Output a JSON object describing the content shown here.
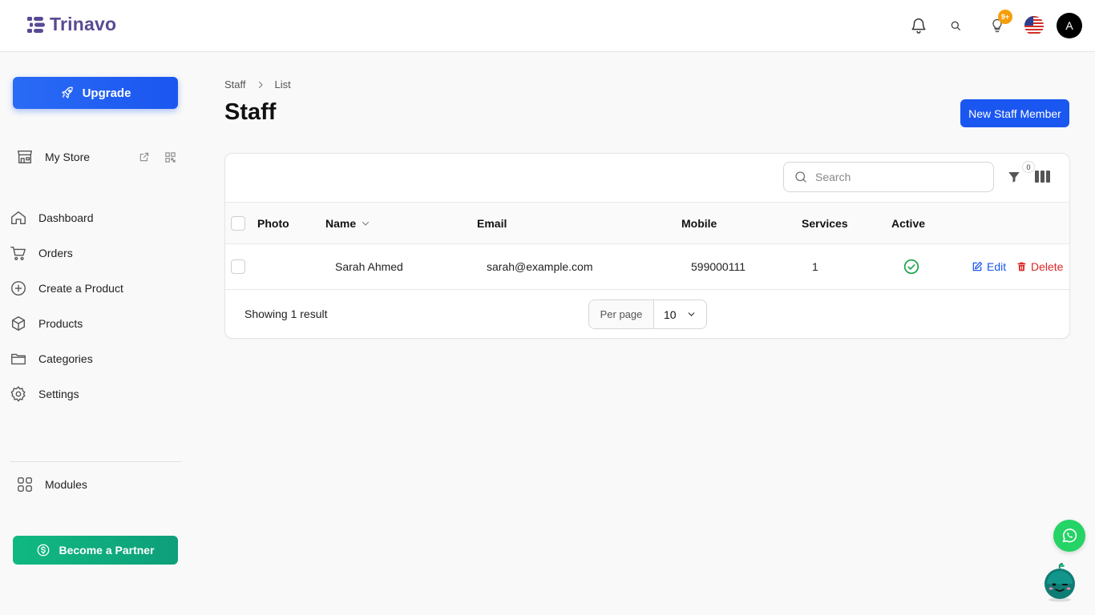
{
  "brand": {
    "name": "Trinavo",
    "color": "#5a4a93"
  },
  "header": {
    "notification_badge": "9+",
    "avatar_initial": "A",
    "language_flag": "us-flag-icon"
  },
  "sidebar": {
    "upgrade_label": "Upgrade",
    "store_label": "My Store",
    "items": [
      {
        "label": "Dashboard",
        "icon": "home-icon"
      },
      {
        "label": "Orders",
        "icon": "cart-icon"
      },
      {
        "label": "Create a Product",
        "icon": "plus-circle-icon"
      },
      {
        "label": "Products",
        "icon": "box-icon"
      },
      {
        "label": "Categories",
        "icon": "folder-icon"
      },
      {
        "label": "Settings",
        "icon": "gear-icon"
      }
    ],
    "modules_label": "Modules",
    "partner_label": "Become a Partner"
  },
  "main": {
    "breadcrumb": [
      "Staff",
      "List"
    ],
    "title": "Staff",
    "new_button": "New Staff Member",
    "search": {
      "placeholder": "Search",
      "value": ""
    },
    "filter_count": "0",
    "columns": [
      "Photo",
      "Name",
      "Email",
      "Mobile",
      "Services",
      "Active"
    ],
    "rows": [
      {
        "photo": "",
        "name": "Sarah Ahmed",
        "email": "sarah@example.com",
        "mobile": "599000111",
        "services": "1",
        "active": true
      }
    ],
    "row_actions": {
      "edit": "Edit",
      "delete": "Delete"
    },
    "footer": {
      "showing": "Showing 1 result",
      "per_page_label": "Per page",
      "per_page_value": "10"
    }
  },
  "colors": {
    "primary": "#1a56f0",
    "success": "#10b981",
    "danger": "#dc2626",
    "whatsapp": "#25d366"
  }
}
